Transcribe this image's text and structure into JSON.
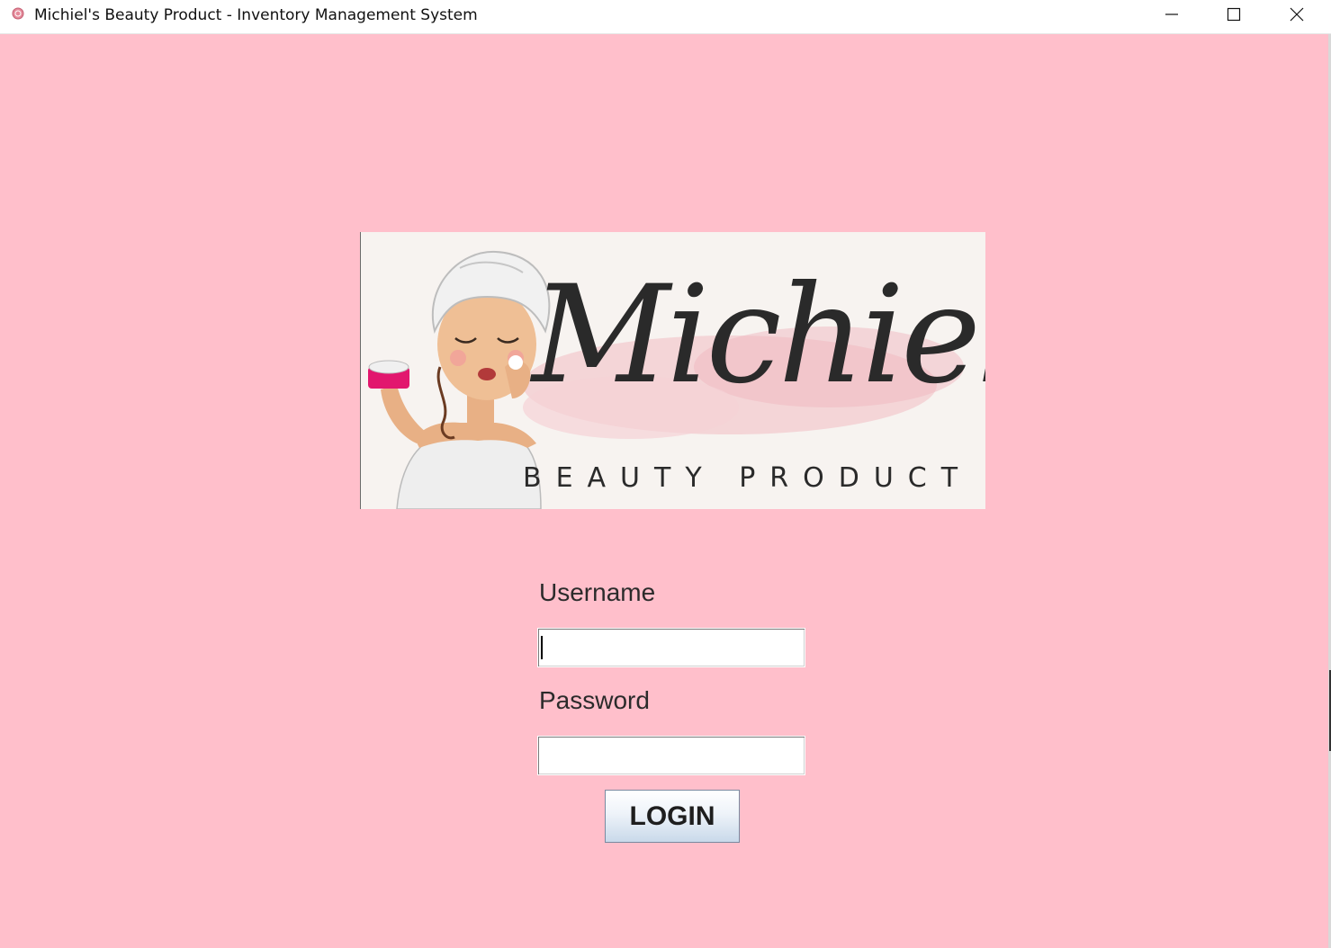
{
  "window": {
    "title": "Michiel's Beauty Product - Inventory Management System"
  },
  "logo": {
    "script_text": "Michiel's",
    "sub_text": "BEAUTY PRODUCT"
  },
  "form": {
    "username_label": "Username",
    "username_value": "",
    "password_label": "Password",
    "password_value": "",
    "login_label": "LOGIN"
  },
  "icons": {
    "app": "cupcake-icon",
    "minimize": "minimize-icon",
    "maximize": "maximize-icon",
    "close": "close-icon"
  },
  "colors": {
    "background": "#ffbfcb",
    "logo_background": "#f7f3f0",
    "titlebar": "#ffffff",
    "text": "#2b2b2b"
  }
}
